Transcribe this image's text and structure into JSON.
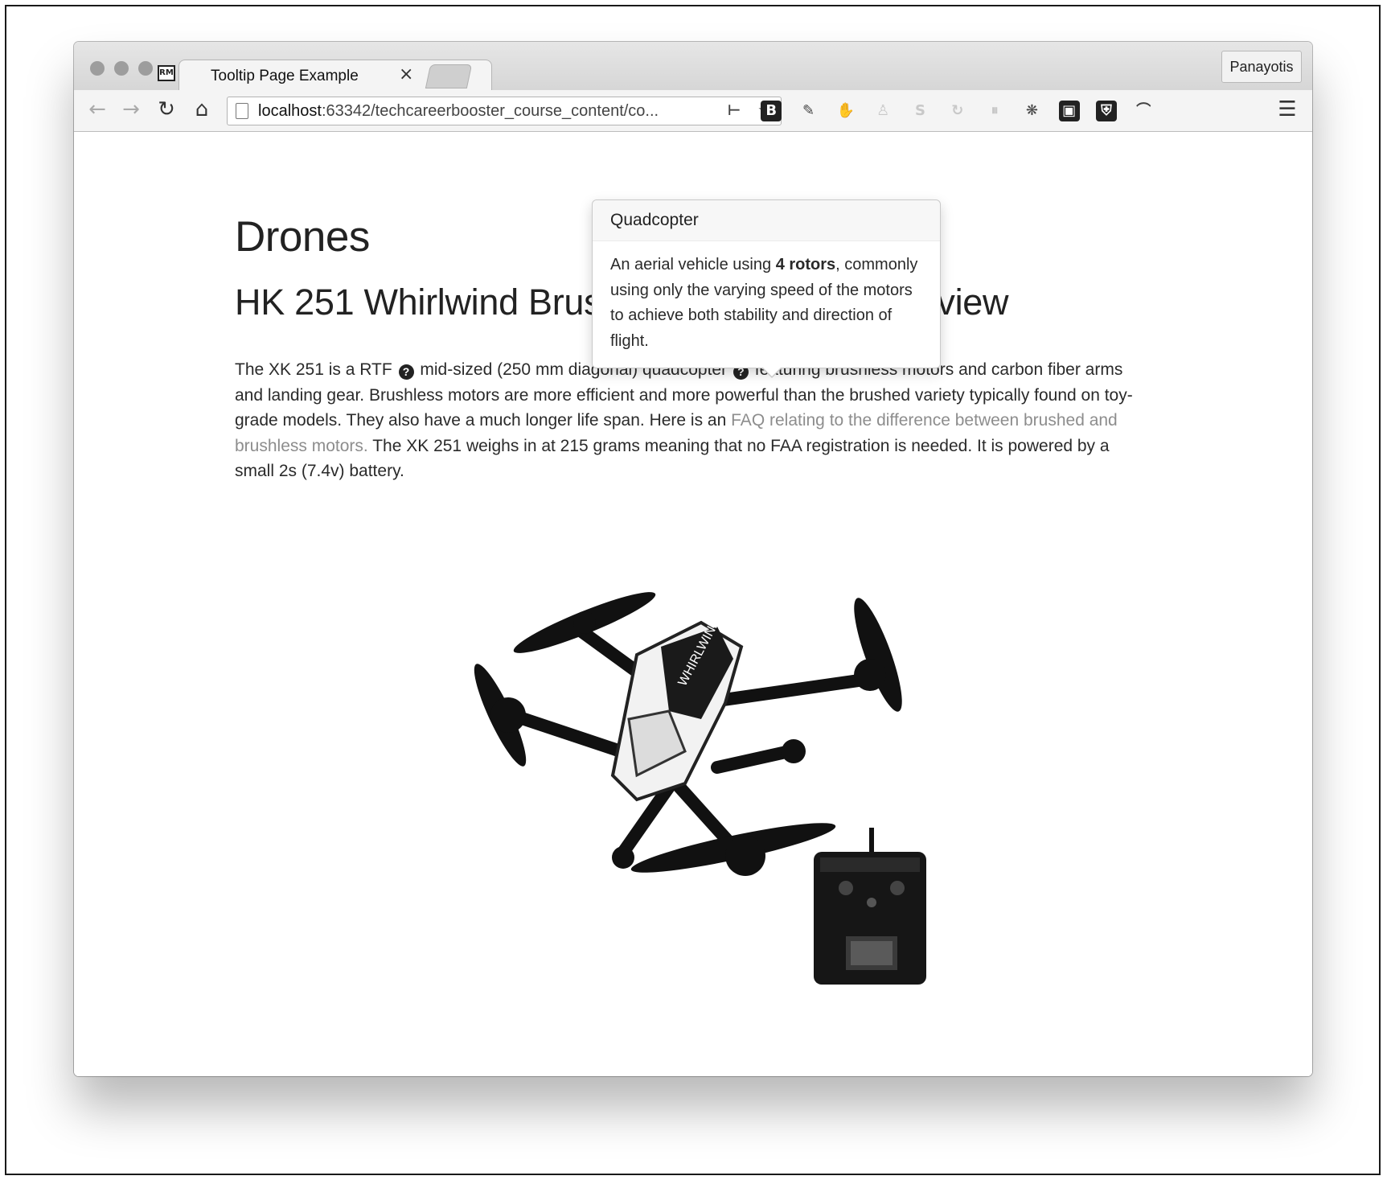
{
  "browser": {
    "tab_title": "Tooltip Page Example",
    "tab_favicon_text": "RM",
    "tab_close": "×",
    "profile_name": "Panayotis",
    "url_host": "localhost",
    "url_rest": ":63342/techcareerbooster_course_content/co...",
    "nav": {
      "back_icon": "←",
      "forward_icon": "→",
      "reload_icon": "↻",
      "home_icon": "⌂"
    },
    "star_icon": "☆",
    "menu_icon": "☰",
    "extensions": [
      {
        "name": "bookmark-extension-icon",
        "glyph": "⊢"
      },
      {
        "name": "bootstrap-extension-icon",
        "glyph": "B"
      },
      {
        "name": "eyedropper-extension-icon",
        "glyph": "✎"
      },
      {
        "name": "hand-extension-icon",
        "glyph": "✋"
      },
      {
        "name": "person-extension-icon",
        "glyph": "♙"
      },
      {
        "name": "skype-extension-icon",
        "glyph": "S"
      },
      {
        "name": "refresh-extension-icon",
        "glyph": "↻"
      },
      {
        "name": "pause-extension-icon",
        "glyph": "⏸"
      },
      {
        "name": "settings-extension-icon",
        "glyph": "❋"
      },
      {
        "name": "screenshot-extension-icon",
        "glyph": "▣"
      },
      {
        "name": "shield-extension-icon",
        "glyph": "⛨"
      },
      {
        "name": "wing-extension-icon",
        "glyph": "⌒"
      }
    ]
  },
  "page": {
    "h1": "Drones",
    "h2": "HK 251 Whirlwind Brushless Quadcopter Review",
    "paragraph": {
      "part1": "The XK 251 is a RTF",
      "part2": "mid-sized (250 mm diagonal) quadcopter",
      "part3": "featuring brushless motors and carbon fiber arms and landing gear. Brushless motors are more efficient and more powerful than the brushed variety typically found on toy-grade models. They also have a much longer life span. Here is an",
      "link": "FAQ relating to the difference between brushed and brushless motors.",
      "part4": "The XK 251 weighs in at 215 grams meaning that no FAA registration is needed. It is powered by a small 2s (7.4v) battery.",
      "help_icon": "?"
    },
    "popover": {
      "title": "Quadcopter",
      "body_before": "An aerial vehicle using",
      "body_bold": "4 rotors",
      "body_after": ", commonly using only the varying speed of the motors to achieve both stability and direction of flight."
    },
    "drone_label": "WHIRLWIND"
  }
}
